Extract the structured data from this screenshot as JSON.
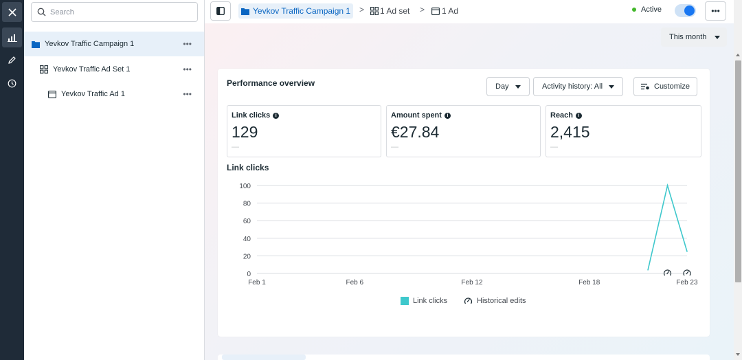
{
  "rail": {
    "items": [
      {
        "name": "close",
        "icon": "close-icon"
      },
      {
        "name": "reporting",
        "icon": "bar-chart-icon"
      },
      {
        "name": "edit",
        "icon": "pencil-icon"
      },
      {
        "name": "history",
        "icon": "clock-icon"
      }
    ]
  },
  "tree": {
    "search_placeholder": "Search",
    "items": [
      {
        "label": "Yevkov Traffic Campaign 1",
        "icon": "folder-icon",
        "selected": true,
        "more": "•••"
      },
      {
        "label": "Yevkov Traffic Ad Set 1",
        "icon": "grid-icon",
        "selected": false,
        "more": "•••"
      },
      {
        "label": "Yevkov Traffic Ad 1",
        "icon": "ad-icon",
        "selected": false,
        "more": "•••"
      }
    ]
  },
  "topbar": {
    "breadcrumb": [
      {
        "label": "Yevkov Traffic Campaign 1",
        "icon": "folder-icon"
      },
      {
        "label": "1 Ad set",
        "icon": "grid-icon"
      },
      {
        "label": "1 Ad",
        "icon": "ad-icon"
      }
    ],
    "separator": ">",
    "status": "Active",
    "toggle_on": true,
    "more": "•••"
  },
  "main": {
    "period": "This month"
  },
  "overview": {
    "title": "Performance overview",
    "granularity": "Day",
    "activity": "Activity history: All",
    "customize": "Customize",
    "metrics": [
      {
        "label": "Link clicks",
        "value": "129",
        "delta": "—"
      },
      {
        "label": "Amount spent",
        "value": "€27.84",
        "delta": "—"
      },
      {
        "label": "Reach",
        "value": "2,415",
        "delta": "—"
      }
    ],
    "chart_title": "Link clicks",
    "legend": {
      "series": "Link clicks",
      "edits": "Historical edits"
    }
  },
  "colors": {
    "accent": "#0a66c2",
    "series": "#3ec8cc",
    "active": "#42b72a"
  },
  "chart_data": {
    "type": "line",
    "title": "Link clicks",
    "xlabel": "",
    "ylabel": "",
    "ylim": [
      0,
      100
    ],
    "yticks": [
      0,
      20,
      40,
      60,
      80,
      100
    ],
    "x_tick_labels": [
      "Feb 1",
      "Feb 6",
      "Feb 12",
      "Feb 18",
      "Feb 23"
    ],
    "x_tick_days": [
      1,
      6,
      12,
      18,
      23
    ],
    "xlim": [
      1,
      23
    ],
    "grid": true,
    "series": [
      {
        "name": "Link clicks",
        "x": [
          21,
          22,
          23
        ],
        "values": [
          4,
          100,
          25
        ]
      }
    ],
    "historical_edits": [
      22,
      23
    ],
    "legend_placement": "bottom"
  }
}
